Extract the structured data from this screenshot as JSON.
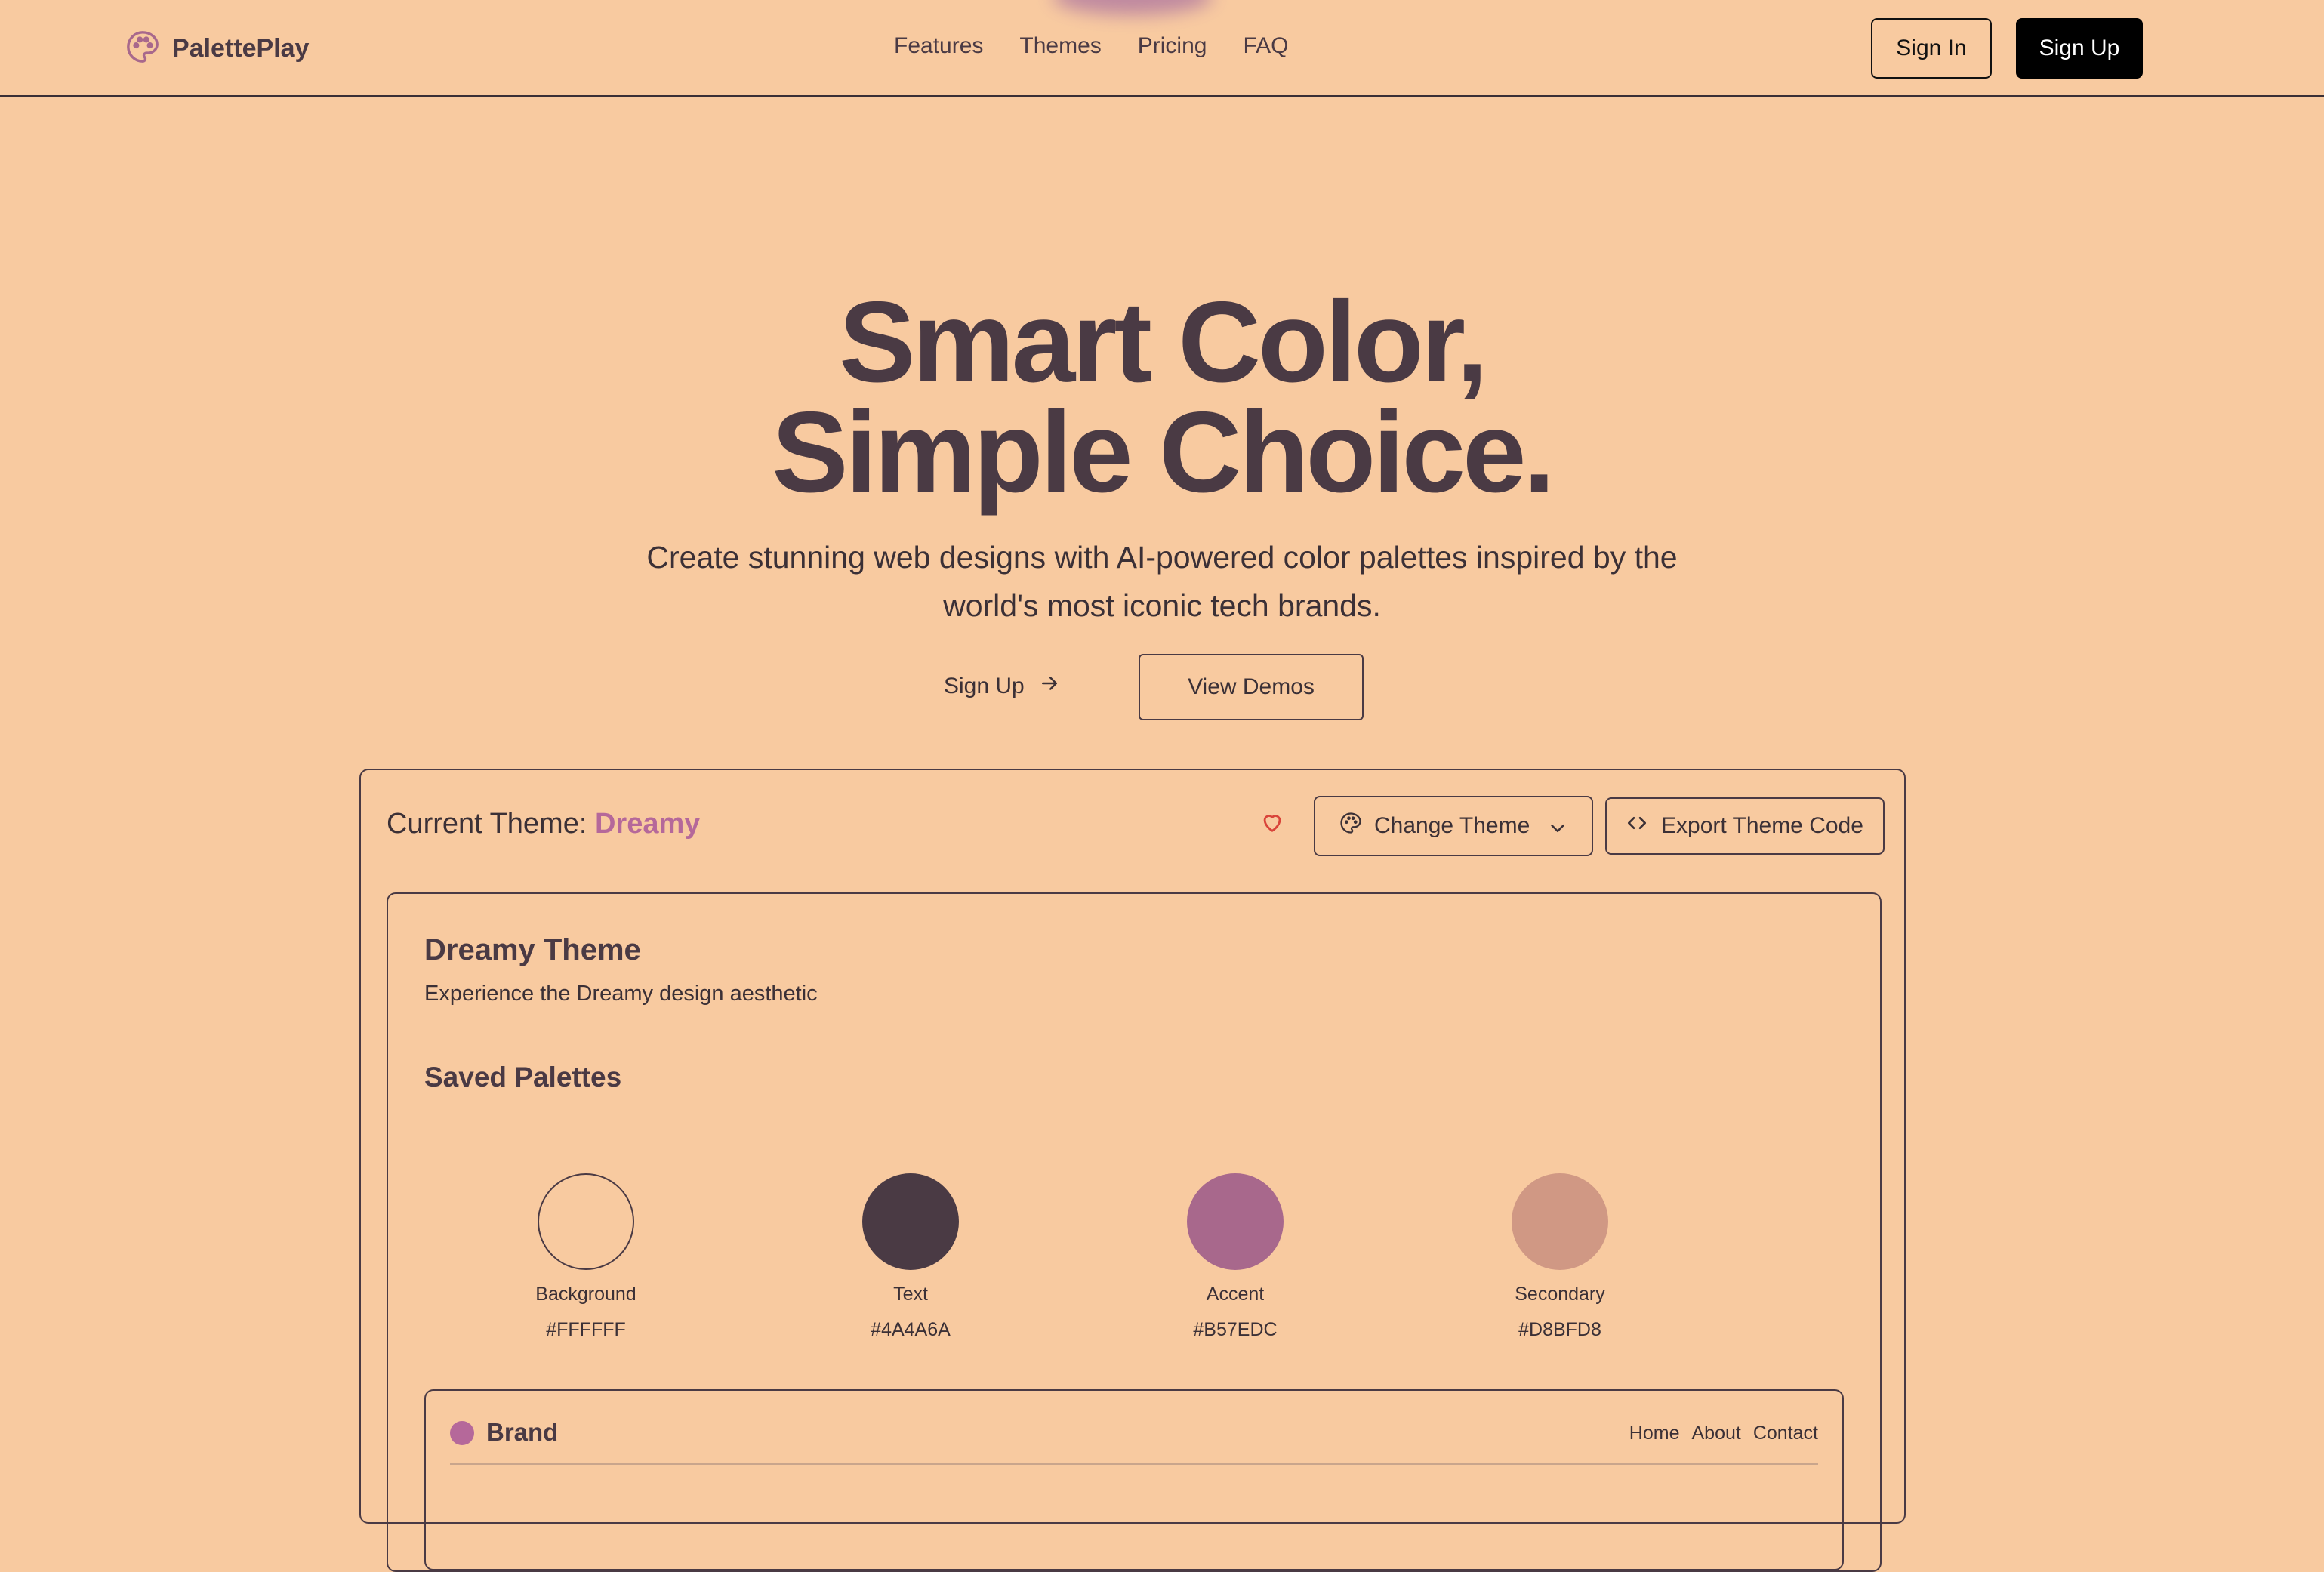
{
  "header": {
    "brand": "PalettePlay",
    "logo_icon": "palette-icon",
    "nav": [
      "Features",
      "Themes",
      "Pricing",
      "FAQ"
    ],
    "sign_in": "Sign In",
    "sign_up": "Sign Up"
  },
  "hero": {
    "title_line1": "Smart Color,",
    "title_line2": "Simple Choice.",
    "subtitle": "Create stunning web designs with AI-powered color palettes inspired by the world's most iconic tech brands.",
    "sign_up": "Sign Up",
    "sign_up_icon": "arrow-right-icon",
    "view_demos": "View Demos"
  },
  "theme_panel": {
    "current_label": "Current Theme:",
    "current_name": "Dreamy",
    "favorite_icon": "heart-icon",
    "change_theme": "Change Theme",
    "change_theme_icon": "palette-icon",
    "export_code": "Export Theme Code",
    "export_icon": "code-icon"
  },
  "theme_card": {
    "title": "Dreamy Theme",
    "subtitle": "Experience the Dreamy design aesthetic",
    "saved_title": "Saved Palettes",
    "swatches": [
      {
        "label": "Background",
        "hex": "#FFFFFF",
        "color": "#F8CAA0",
        "outlined": true
      },
      {
        "label": "Text",
        "hex": "#4A4A6A",
        "color": "#4A3A44",
        "outlined": false
      },
      {
        "label": "Accent",
        "hex": "#B57EDC",
        "color": "#A8688C",
        "outlined": false
      },
      {
        "label": "Secondary",
        "hex": "#D8BFD8",
        "color": "#D09884",
        "outlined": false
      }
    ]
  },
  "preview": {
    "brand": "Brand",
    "nav": [
      "Home",
      "About",
      "Contact"
    ]
  },
  "colors": {
    "page_bg": "#F8CAA0",
    "text": "#4A3A44",
    "accent": "#B5689A",
    "heart": "#D9443A"
  }
}
